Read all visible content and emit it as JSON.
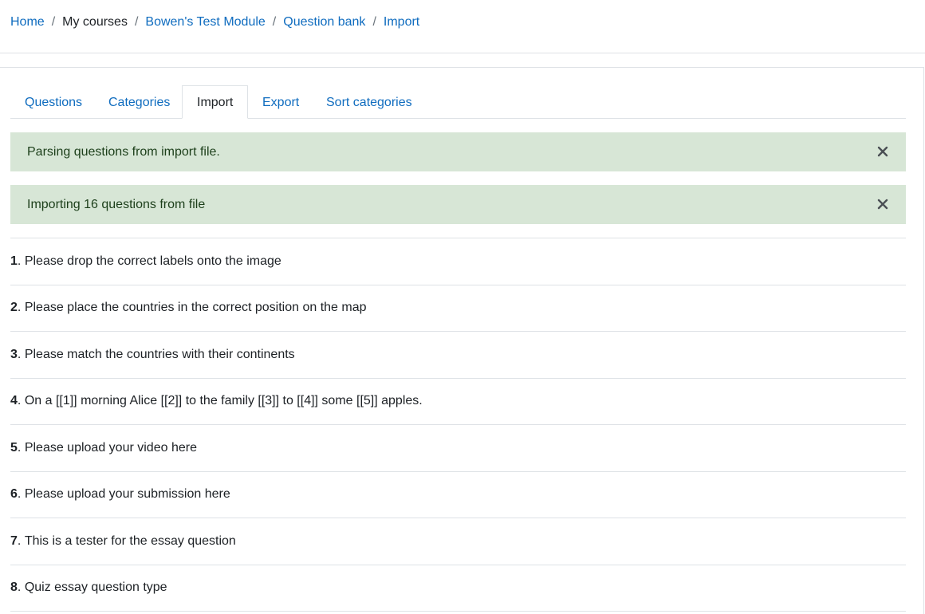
{
  "breadcrumb": {
    "items": [
      {
        "label": "Home"
      },
      {
        "label": "My courses"
      },
      {
        "label": "Bowen's Test Module"
      },
      {
        "label": "Question bank"
      },
      {
        "label": "Import"
      }
    ],
    "separator": "/"
  },
  "tabs": [
    {
      "label": "Questions"
    },
    {
      "label": "Categories"
    },
    {
      "label": "Import"
    },
    {
      "label": "Export"
    },
    {
      "label": "Sort categories"
    }
  ],
  "active_tab": "Import",
  "alerts": [
    {
      "message": "Parsing questions from import file.",
      "close_icon": "close-icon"
    },
    {
      "message": "Importing 16 questions from file",
      "close_icon": "close-icon"
    }
  ],
  "questions": [
    {
      "number": "1",
      "text": "Please drop the correct labels onto the image"
    },
    {
      "number": "2",
      "text": "Please place the countries in the correct position on the map"
    },
    {
      "number": "3",
      "text": "Please match the countries with their continents"
    },
    {
      "number": "4",
      "text": "On a [[1]] morning Alice [[2]] to the family [[3]] to [[4]] some [[5]] apples."
    },
    {
      "number": "5",
      "text": "Please upload your video here"
    },
    {
      "number": "6",
      "text": "Please upload your submission here"
    },
    {
      "number": "7",
      "text": "This is a tester for the essay question"
    },
    {
      "number": "8",
      "text": "Quiz essay question type"
    }
  ],
  "question_number_suffix": ".",
  "colors": {
    "link": "#0f6cbf",
    "alert_success_bg": "#d7e6d6",
    "alert_success_text": "#1c3f1a",
    "border": "#dee2e6"
  }
}
